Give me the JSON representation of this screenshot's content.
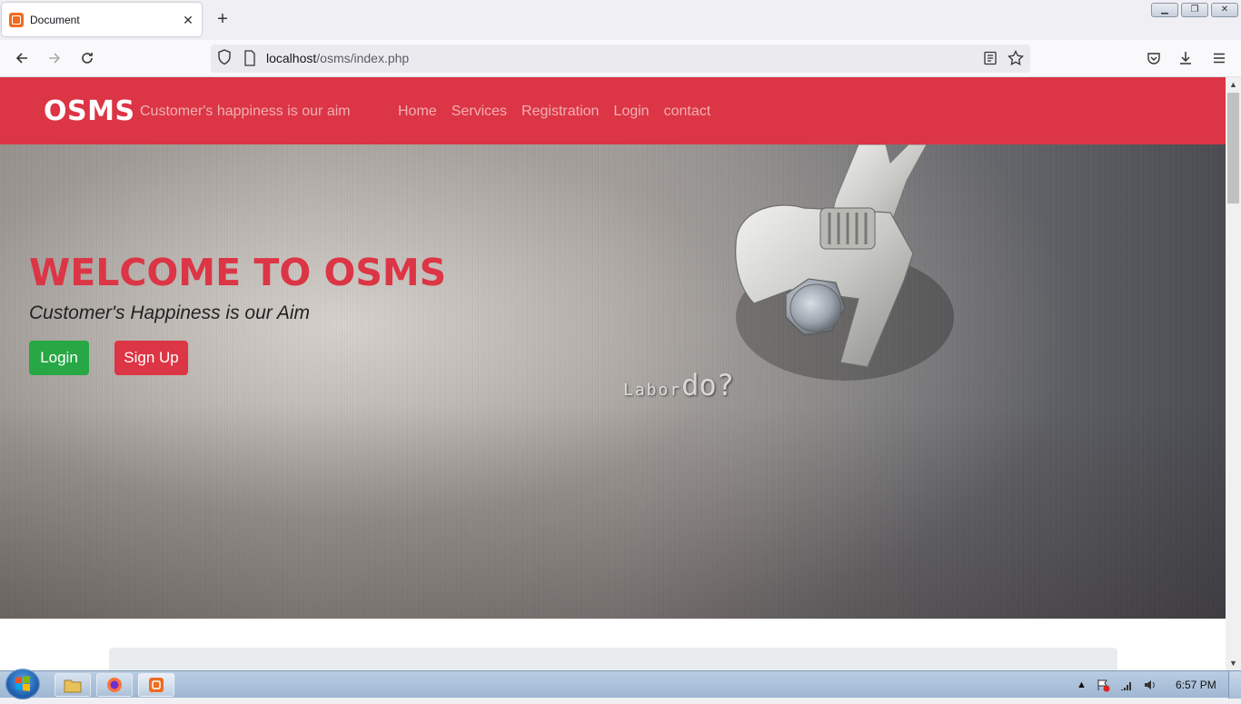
{
  "browser": {
    "tab_title": "Document",
    "url_host": "localhost",
    "url_path": "/osms/index.php"
  },
  "site": {
    "brand": "OSMS",
    "tagline": "Customer's happiness is our aim",
    "menu": [
      "Home",
      "Services",
      "Registration",
      "Login",
      "contact"
    ],
    "accent_color": "#dc3545",
    "success_color": "#28a745"
  },
  "hero": {
    "title": "WELCOME TO OSMS",
    "subtitle": "Customer's Happiness is our Aim",
    "login_label": "Login",
    "signup_label": "Sign Up",
    "watermark_small": "Labor",
    "watermark_big": "do?"
  },
  "taskbar": {
    "clock": "6:57 PM",
    "items": [
      "windows-explorer-icon",
      "firefox-icon",
      "xampp-icon"
    ]
  }
}
